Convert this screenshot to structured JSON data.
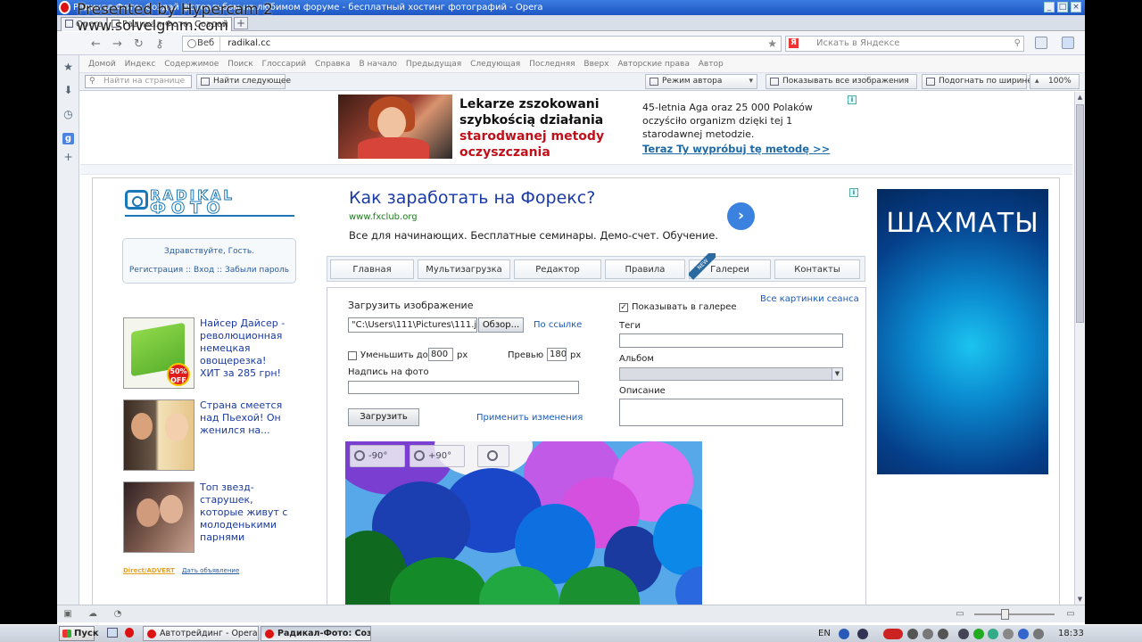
{
  "browser": {
    "window_title": "Радикал-Фото: Создай фотоальбом на любимом форуме - бесплатный хостинг фотографий - Opera",
    "watermark_line1": "Presented by Hypercam 2",
    "watermark_line2": "www.solvelgmm.com",
    "tabs": [
      {
        "label": "Opera"
      },
      {
        "label": "Радикал-Фото: Создай"
      }
    ],
    "address": {
      "scope": "Веб",
      "url": "radikal.cc"
    },
    "search_placeholder": "Искать в Яндексе",
    "menu": [
      "Домой",
      "Индекс",
      "Содержимое",
      "Поиск",
      "Глоссарий",
      "Справка",
      "В начало",
      "Предыдущая",
      "Следующая",
      "Последняя",
      "Вверх",
      "Авторские права",
      "Автор"
    ],
    "find": {
      "placeholder": "Найти на странице",
      "next_label": "Найти следующее",
      "author_mode": "Режим автора",
      "show_images": "Показывать все изображения",
      "fit_width": "Подогнать по ширине",
      "zoom": "100%"
    }
  },
  "top_ad": {
    "headline_black": "Lekarze zszokowani szybkością działania",
    "headline_red": "starodwanej metody oczyszczania",
    "description": "45-letnia Aga oraz 25 000 Polaków oczyściło organizm dzięki tej 1 starodawnej metodzie.",
    "cta": "Teraz Ty wypróbuj tę metodę >>",
    "info_glyph": "i"
  },
  "site": {
    "logo_line1": "RADIKAL",
    "logo_line2": "ФОТО",
    "greeting": "Здравствуйте, Гость.",
    "auth_links": "Регистрация :: Вход :: Забыли пароль",
    "side_ads": [
      {
        "text": "Найсер Дайсер - революционная немецкая овощерезка! ХИТ за 285 грн!",
        "badge": "50% OFF"
      },
      {
        "text": "Страна смеется над Пьехой! Он женился на..."
      },
      {
        "text": "Топ звезд-старушек, которые живут с молоденькими парнями"
      }
    ],
    "direct_label": "Direct/ADVERT",
    "direct_link": "Дать объявление"
  },
  "forex_ad": {
    "title": "Как заработать на Форекс?",
    "url": "www.fxclub.org",
    "description": "Все для начинающих. Бесплатные семинары. Демо-счет. Обучение.",
    "arrow": "›"
  },
  "nav": {
    "tabs": [
      "Главная",
      "Мультизагрузка",
      "Редактор",
      "Правила",
      "Галереи",
      "Контакты"
    ],
    "new_badge": "NEW"
  },
  "upload": {
    "title": "Загрузить изображение",
    "file_value": "\"C:\\Users\\111\\Pictures\\111.jp",
    "browse_label": "Обзор...",
    "by_link": "По ссылке",
    "reduce_label": "Уменьшить до",
    "reduce_value": "800",
    "px": "px",
    "preview_label": "Превью",
    "preview_value": "180",
    "caption_label": "Надпись на фото",
    "upload_button": "Загрузить",
    "apply_changes": "Применить изменения",
    "all_session": "Все картинки сеанса",
    "show_in_gallery": "Показывать в галерее",
    "show_in_gallery_checked": true,
    "tags_label": "Теги",
    "album_label": "Альбом",
    "description_label": "Описание",
    "rotate_left": "-90°",
    "rotate_right": "+90°"
  },
  "right_ad": {
    "text": "ШАХМАТЫ"
  },
  "taskbar": {
    "start": "Пуск",
    "tasks": [
      "Автотрейдинг - Opera",
      "Радикал-Фото: Соз..."
    ],
    "lang": "EN",
    "time": "18:33"
  },
  "colors": {
    "link": "#1a5ab8",
    "ad_red": "#c0101a",
    "ad_cta": "#1e6aa8",
    "chess_bg": "#0a8ad0"
  }
}
